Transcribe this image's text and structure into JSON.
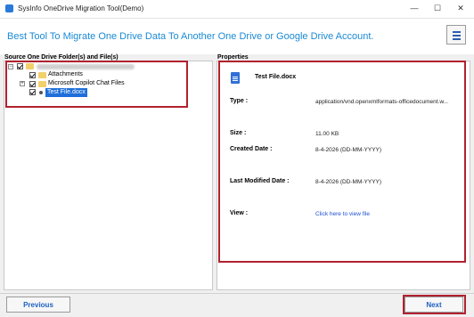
{
  "window": {
    "title": "SysInfo OneDrive Migration Tool(Demo)",
    "min": "—",
    "max": "☐",
    "close": "✕"
  },
  "banner": {
    "tagline": "Best Tool To Migrate One Drive Data To Another One Drive or Google Drive Account."
  },
  "left": {
    "label": "Source One Drive Folder(s) and File(s)",
    "tree": [
      {
        "label": "Attachments"
      },
      {
        "label": "Microsoft Copilot Chat Files"
      },
      {
        "label": "Test File.docx"
      }
    ]
  },
  "right": {
    "label": "Properties",
    "file_name": "Test File.docx",
    "props": {
      "type_key": "Type :",
      "type_val": "application/vnd.openxmlformats-officedocument.w...",
      "size_key": "Size :",
      "size_val": "11.00 KB",
      "created_key": "Created Date :",
      "created_val": "8-4-2026 (DD-MM-YYYY)",
      "modified_key": "Last Modified Date :",
      "modified_val": "8-4-2026 (DD-MM-YYYY)",
      "view_key": "View :",
      "view_val": "Click here to view file"
    }
  },
  "footer": {
    "previous": "Previous",
    "next": "Next"
  },
  "colors": {
    "accent": "#1a8ad4",
    "highlight": "#b1212f",
    "link": "#1a4fd0"
  }
}
